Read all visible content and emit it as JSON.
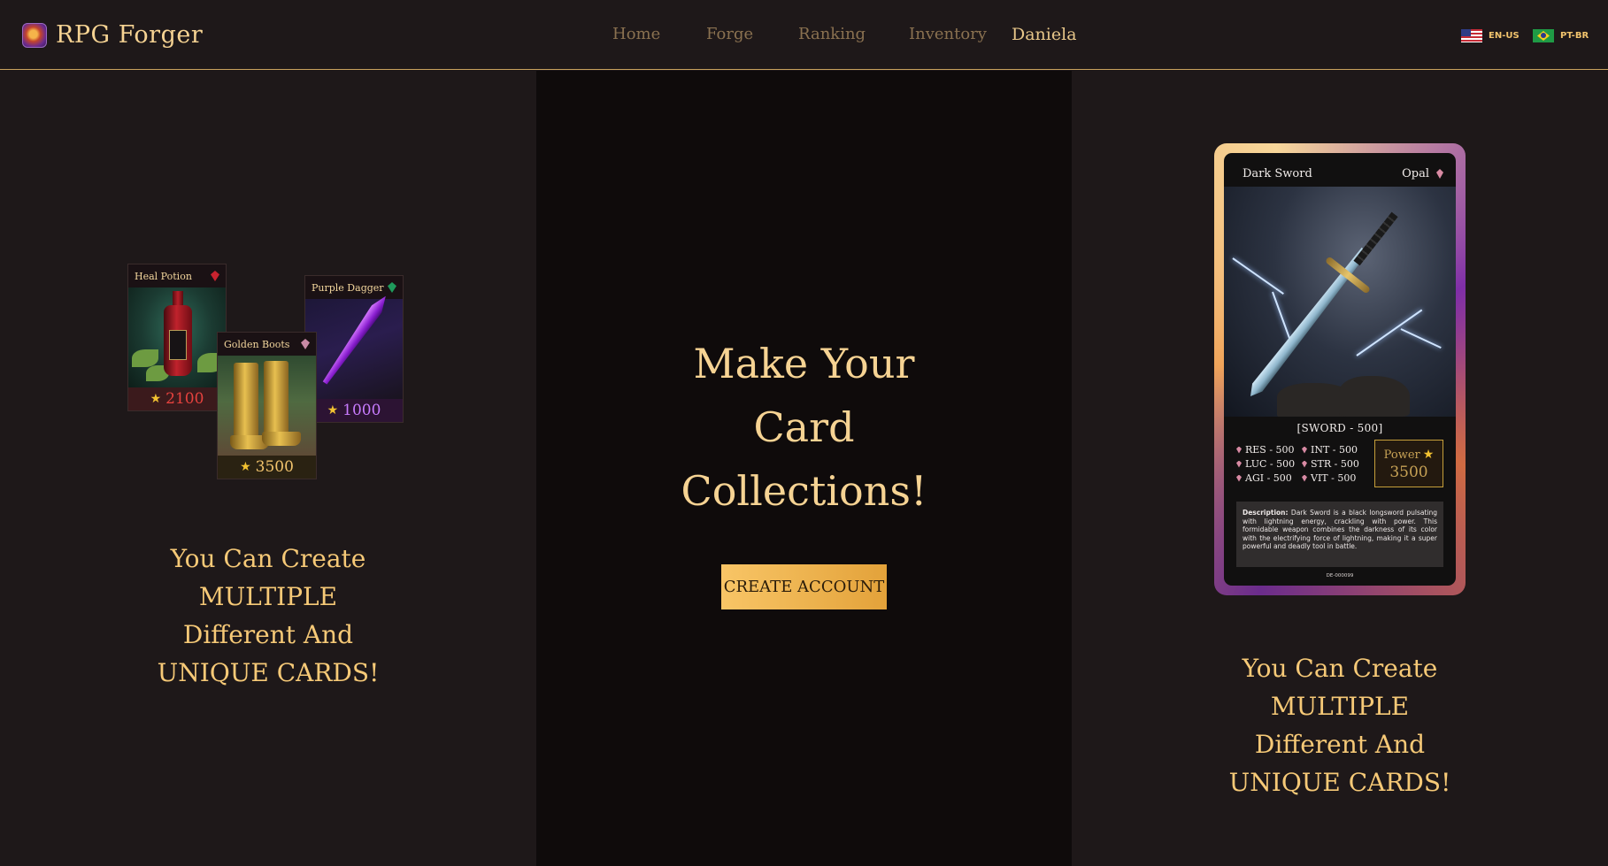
{
  "brand": {
    "name": "RPG Forger"
  },
  "nav": {
    "items": [
      {
        "label": "Home"
      },
      {
        "label": "Forge"
      },
      {
        "label": "Ranking"
      },
      {
        "label": "Inventory"
      }
    ],
    "user": "Daniela"
  },
  "languages": [
    {
      "code": "EN-US",
      "flag": "us-flag-icon"
    },
    {
      "code": "PT-BR",
      "flag": "br-flag-icon"
    }
  ],
  "left": {
    "cards": [
      {
        "name": "Heal Potion",
        "power": "2100",
        "gem_color": "#c9232f"
      },
      {
        "name": "Golden Boots",
        "power": "3500",
        "gem_color": "#c98aa6"
      },
      {
        "name": "Purple Dagger",
        "power": "1000",
        "gem_color": "#1f9a5c"
      }
    ],
    "text": [
      "You Can Create",
      "MULTIPLE",
      "Different And",
      "UNIQUE CARDS!"
    ]
  },
  "middle": {
    "headline": [
      "Make Your",
      "Card",
      "Collections!"
    ],
    "cta": "CREATE ACCOUNT"
  },
  "right": {
    "card": {
      "name": "Dark Sword",
      "rarity": "Opal",
      "type": "[SWORD - 500]",
      "stats": [
        "RES - 500",
        "INT - 500",
        "LUC - 500",
        "STR - 500",
        "AGI - 500",
        "VIT - 500"
      ],
      "power_label": "Power",
      "power_value": "3500",
      "description_label": "Description:",
      "description": "Dark Sword is a black longsword pulsating with lightning energy, crackling with power. This formidable weapon combines the darkness of its color with the electrifying force of lightning, making it a super powerful and deadly tool in battle.",
      "serial": "DE-000099"
    },
    "text": [
      "You Can Create",
      "MULTIPLE",
      "Different And",
      "UNIQUE CARDS!"
    ]
  },
  "colors": {
    "accent": "#f6c977",
    "background": "#1e1819",
    "center_panel": "#0f0b0b",
    "button": "#f0b04f"
  }
}
